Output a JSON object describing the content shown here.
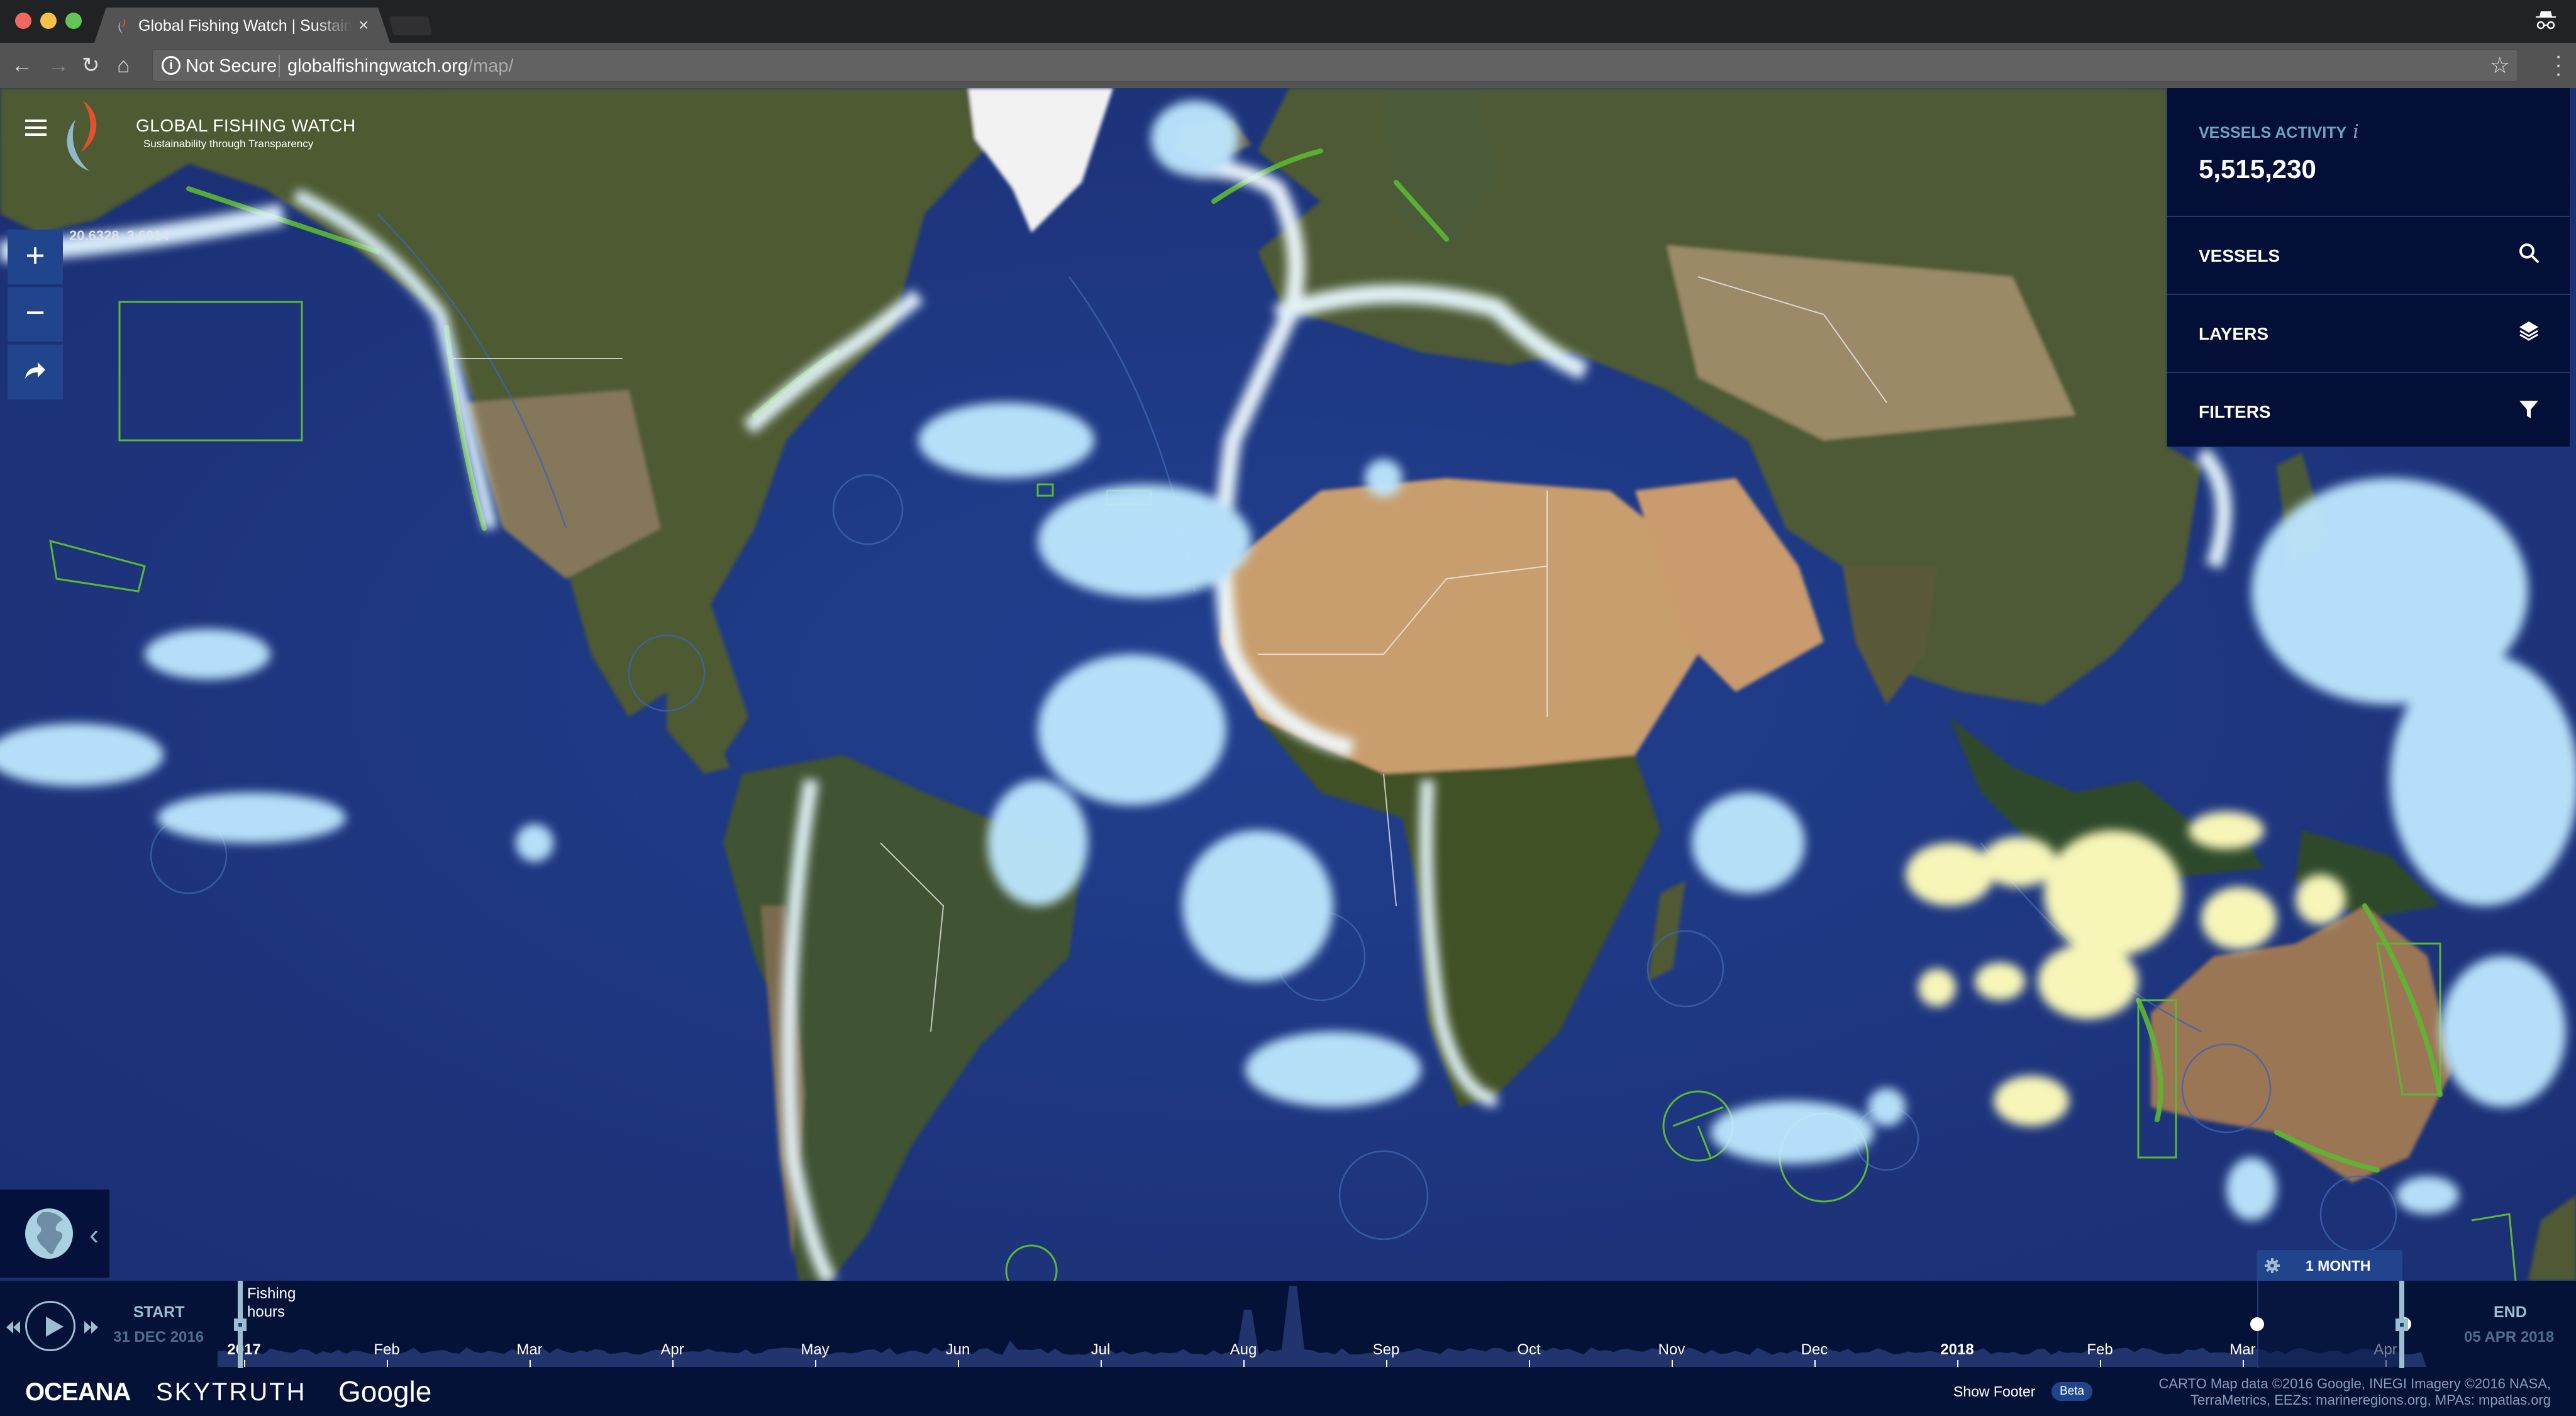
{
  "browser": {
    "tab_title": "Global Fishing Watch | Sustainability through Transparency",
    "tab_close": "×",
    "security_label": "Not Secure",
    "url_host": "globalfishingwatch.org",
    "url_path": "/map/",
    "icons": [
      "back-icon",
      "forward-icon",
      "reload-icon",
      "home-icon",
      "info-icon",
      "bookmark-star-icon",
      "menu-dots-icon",
      "incognito-icon"
    ]
  },
  "header": {
    "brand_title": "GLOBAL FISHING WATCH",
    "brand_subtitle": "Sustainability through Transparency",
    "coordinates": "20.6328, 3.6914"
  },
  "map_controls": {
    "zoom_in": "+",
    "zoom_out": "−",
    "share": "share-icon",
    "collapse_chevron": "‹"
  },
  "panel": {
    "activity_label": "VESSELS ACTIVITY",
    "activity_info": "i",
    "activity_value": "5,515,230",
    "items": [
      {
        "label": "VESSELS",
        "icon": "search-icon"
      },
      {
        "label": "LAYERS",
        "icon": "layers-icon"
      },
      {
        "label": "FILTERS",
        "icon": "filter-icon"
      }
    ]
  },
  "timebar": {
    "start_label": "START",
    "start_date": "31 DEC 2016",
    "end_label": "END",
    "end_date": "05 APR 2018",
    "histogram_label_line1": "Fishing",
    "histogram_label_line2": "hours",
    "duration_label": "1 MONTH",
    "ticks": [
      {
        "label": "2017",
        "year": true
      },
      {
        "label": "Feb"
      },
      {
        "label": "Mar"
      },
      {
        "label": "Apr"
      },
      {
        "label": "May"
      },
      {
        "label": "Jun"
      },
      {
        "label": "Jul"
      },
      {
        "label": "Aug"
      },
      {
        "label": "Sep"
      },
      {
        "label": "Oct"
      },
      {
        "label": "Nov"
      },
      {
        "label": "Dec"
      },
      {
        "label": "2018",
        "year": true
      },
      {
        "label": "Feb"
      },
      {
        "label": "Mar"
      },
      {
        "label": "Apr"
      }
    ]
  },
  "footer": {
    "partners": [
      "OCEANA",
      "SKYTRUTH",
      "Google"
    ],
    "show_footer": "Show Footer",
    "beta": "Beta",
    "attribution_line1": "CARTO Map data ©2016 Google, INEGI Imagery ©2016 NASA,",
    "attribution_line2": "TerraMetrics, EEZs: marineregions.org, MPAs: mpatlas.org"
  },
  "colors": {
    "panel_bg": "#030f37",
    "accent_blue": "#21458c",
    "label_teal": "#6da4c0",
    "handle": "#9dbdd0",
    "fishing_heat": "#bfe8ff",
    "fishing_heat_hot": "#f7f6b8",
    "mpa_outline": "#5cb832"
  }
}
